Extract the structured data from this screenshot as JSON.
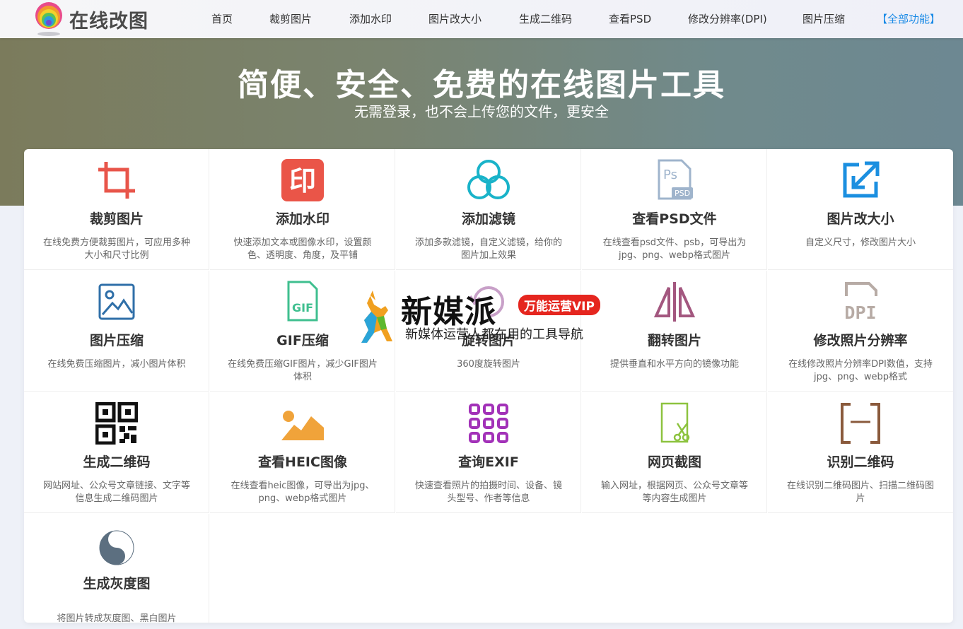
{
  "header": {
    "logo_text": "在线改图",
    "nav": [
      {
        "label": "首页"
      },
      {
        "label": "裁剪图片"
      },
      {
        "label": "添加水印"
      },
      {
        "label": "图片改大小"
      },
      {
        "label": "生成二维码"
      },
      {
        "label": "查看PSD"
      },
      {
        "label": "修改分辨率(DPI)"
      },
      {
        "label": "图片压缩"
      },
      {
        "label": "【全部功能】"
      }
    ]
  },
  "hero": {
    "title": "简便、安全、免费的在线图片工具",
    "subtitle": "无需登录，也不会上传您的文件，更安全"
  },
  "tools": [
    {
      "title": "裁剪图片",
      "desc": "在线免费方便裁剪图片，可应用多种大小和尺寸比例",
      "icon": "crop-icon",
      "color": "#e8554a"
    },
    {
      "title": "添加水印",
      "desc": "快速添加文本或图像水印，设置颜色、透明度、角度，及平铺",
      "icon": "watermark-icon",
      "color": "#ea5548",
      "icon_text": "印"
    },
    {
      "title": "添加滤镜",
      "desc": "添加多款滤镜，自定义滤镜，给你的图片加上效果",
      "icon": "filter-icon",
      "color": "#19b3c9"
    },
    {
      "title": "查看PSD文件",
      "desc": "在线查看psd文件、psb，可导出为jpg、png、webp格式图片",
      "icon": "psd-file-icon",
      "color": "#9fb4cc",
      "icon_text": "Ps",
      "icon_text2": "PSD"
    },
    {
      "title": "图片改大小",
      "desc": "自定义尺寸，修改图片大小",
      "icon": "resize-icon",
      "color": "#1b8fe0"
    },
    {
      "title": "图片压缩",
      "desc": "在线免费压缩图片，减小图片体积",
      "icon": "image-compress-icon",
      "color": "#2f6fa8"
    },
    {
      "title": "GIF压缩",
      "desc": "在线免费压缩GIF图片，减少GIF图片体积",
      "icon": "gif-file-icon",
      "color": "#3fbf8f",
      "icon_text": "GIF"
    },
    {
      "title": "旋转图片",
      "desc": "360度旋转图片",
      "icon": "rotate-icon",
      "color": "#c8a0c8"
    },
    {
      "title": "翻转图片",
      "desc": "提供垂直和水平方向的镜像功能",
      "icon": "flip-icon",
      "color": "#a3577f"
    },
    {
      "title": "修改照片分辨率",
      "desc": "在线修改照片分辨率DPI数值，支持jpg、png、webp格式",
      "icon": "dpi-icon",
      "color": "#b7aba5",
      "icon_text": "DPI"
    },
    {
      "title": "生成二维码",
      "desc": "网站网址、公众号文章链接、文字等信息生成二维码图片",
      "icon": "qrcode-icon",
      "color": "#111111"
    },
    {
      "title": "查看HEIC图像",
      "desc": "在线查看heic图像，可导出为jpg、png、webp格式图片",
      "icon": "heic-image-icon",
      "color": "#f0a33a"
    },
    {
      "title": "查询EXIF",
      "desc": "快速查看照片的拍摄时间、设备、镜头型号、作者等信息",
      "icon": "exif-grid-icon",
      "color": "#a231b8"
    },
    {
      "title": "网页截图",
      "desc": "输入网址，根据网页、公众号文章等等内容生成图片",
      "icon": "webpage-screenshot-icon",
      "color": "#8dc33f"
    },
    {
      "title": "识别二维码",
      "desc": "在线识别二维码图片、扫描二维码图片",
      "icon": "scan-qrcode-icon",
      "color": "#8a5a3c"
    },
    {
      "title": "生成灰度图",
      "desc": "将图片转成灰度图、黑白图片",
      "icon": "grayscale-icon",
      "color": "#5c6f80"
    }
  ],
  "watermark": {
    "title": "新媒派",
    "badge": "万能运营VIP",
    "subtitle": "新媒体运营人都在用的工具导航"
  }
}
